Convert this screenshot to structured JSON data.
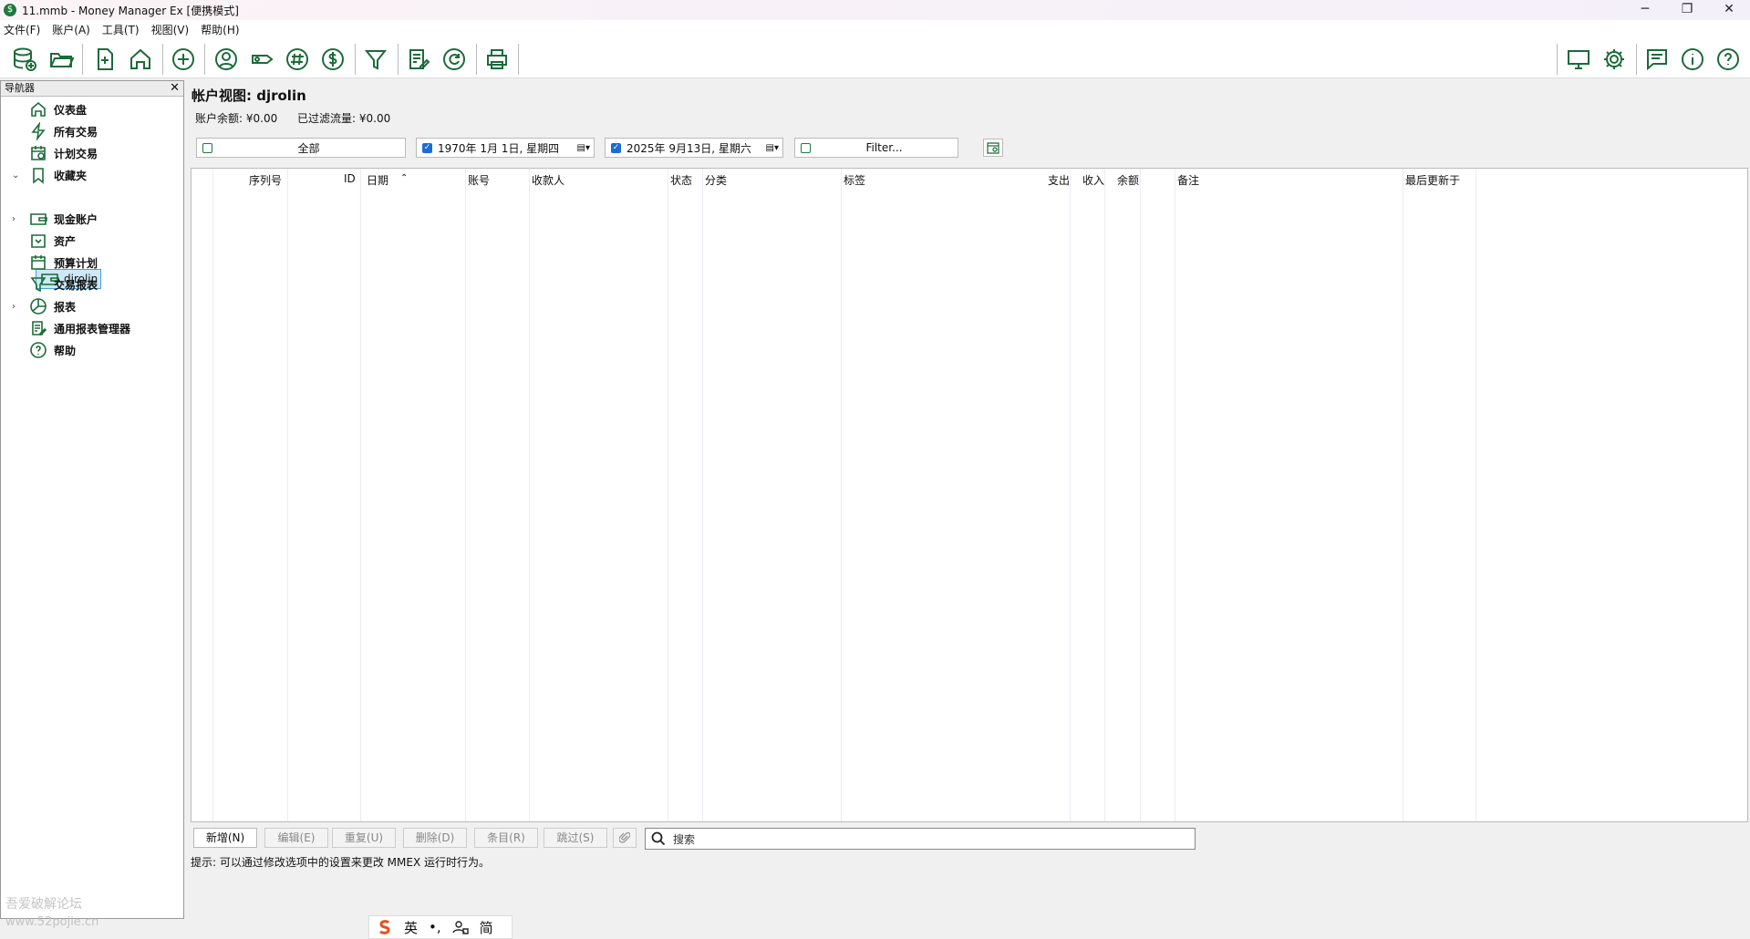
{
  "window": {
    "title": "11.mmb - Money Manager Ex [便携模式]",
    "app_icon": "$",
    "controls": [
      "─",
      "❐",
      "✕"
    ]
  },
  "menu": [
    "文件(F)",
    "账户(A)",
    "工具(T)",
    "视图(V)",
    "帮助(H)"
  ],
  "navigator": {
    "header": "导航器",
    "close": "✕",
    "items": [
      {
        "label": "仪表盘",
        "icon": "home-icon",
        "expander": ""
      },
      {
        "label": "所有交易",
        "icon": "lightning-icon",
        "expander": ""
      },
      {
        "label": "计划交易",
        "icon": "calendar-clock-icon",
        "expander": ""
      },
      {
        "label": "收藏夹",
        "icon": "bookmark-icon",
        "expander": "⌄"
      },
      {
        "label": "现金账户",
        "icon": "wallet-icon",
        "expander": "›"
      },
      {
        "label": "资产",
        "icon": "asset-icon",
        "expander": ""
      },
      {
        "label": "预算计划",
        "icon": "calendar-icon",
        "expander": ""
      },
      {
        "label": "交易报表",
        "icon": "filter-icon",
        "expander": ""
      },
      {
        "label": "报表",
        "icon": "pie-chart-icon",
        "expander": "›"
      },
      {
        "label": "通用报表管理器",
        "icon": "report-edit-icon",
        "expander": ""
      },
      {
        "label": "帮助",
        "icon": "help-icon",
        "expander": ""
      }
    ],
    "selected_child": "djrolin"
  },
  "account": {
    "title": "帐户视图:  djrolin",
    "balance_label": "账户余额:  ¥0.00",
    "filtered_label": "已过滤流量:  ¥0.00"
  },
  "filters": {
    "all": "全部",
    "date_from": "1970年  1月  1日, 星期四",
    "date_to": "2025年  9月13日, 星期六",
    "filter": "Filter..."
  },
  "columns": [
    "序列号",
    "ID",
    "日期",
    "账号",
    "收款人",
    "状态",
    "分类",
    "标签",
    "支出",
    "收入",
    "余额",
    "备注",
    "最后更新于"
  ],
  "buttons": {
    "new": "新增(N)",
    "edit": "编辑(E)",
    "duplicate": "重复(U)",
    "delete": "删除(D)",
    "entry": "条目(R)",
    "skip": "跳过(S)"
  },
  "search": {
    "placeholder": "搜索"
  },
  "tip": "提示:  可以通过修改选项中的设置来更改 MMEX 运行时行为。",
  "ime": [
    "英",
    "•,",
    "简"
  ],
  "watermark": [
    "吾爱破解论坛",
    "www.52pojie.cn"
  ],
  "colors": {
    "accent": "#1c6b3a",
    "selection": "#cde8f6"
  }
}
